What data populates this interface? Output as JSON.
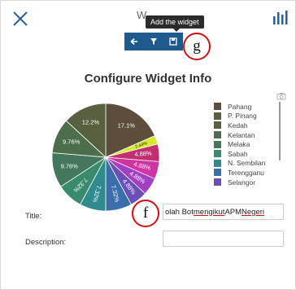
{
  "header": {
    "title_partial": "W",
    "tooltip": "Add the widget",
    "close_icon": "close-icon",
    "chart_icon": "bar-chart-icon"
  },
  "toolbar": {
    "buttons": [
      "arrow-left-icon",
      "filter-icon",
      "save-icon"
    ],
    "color": "#1e5a8e"
  },
  "callouts": {
    "g": "g",
    "f": "f"
  },
  "heading": "Configure Widget Info",
  "chart_data": {
    "type": "pie",
    "title": "",
    "categories": [
      "Pahang",
      "P. Pinang",
      "Kedah",
      "Kelantan",
      "Melaka",
      "Sabah",
      "N. Sembilan",
      "Terengganu",
      "Selangor"
    ],
    "slice_labels": [
      "17.1%",
      "2.44%",
      "4.88%",
      "4.88%",
      "4.88%",
      "4.88%",
      "7.32%",
      "7.32%",
      "7.32%",
      "9.76%",
      "9.76%",
      "12.2%"
    ],
    "slice_values": [
      17.1,
      2.44,
      4.88,
      4.88,
      4.88,
      4.88,
      7.32,
      7.32,
      7.32,
      9.76,
      9.76,
      12.2
    ],
    "slice_colors": [
      "#5d4e3b",
      "#d6ea32",
      "#c22e6f",
      "#cf34a4",
      "#a33fc4",
      "#6a4fb7",
      "#3a6fab",
      "#2f8b8e",
      "#3a8b6e",
      "#43795a",
      "#4d6e4b",
      "#58613f"
    ],
    "legend_colors": [
      "#5d4e3b",
      "#5f5d3f",
      "#58613f",
      "#4d6e4b",
      "#43795a",
      "#3a8b6e",
      "#2f8b8e",
      "#3a6fab",
      "#6a4fb7"
    ],
    "legend_position": "right"
  },
  "form": {
    "title_label": "Title:",
    "title_value_prefix": "olah Bot ",
    "title_value_mid": "mengikut",
    "title_value_gap": " APM ",
    "title_value_end": "Negeri",
    "description_label": "Description:",
    "description_value": ""
  }
}
